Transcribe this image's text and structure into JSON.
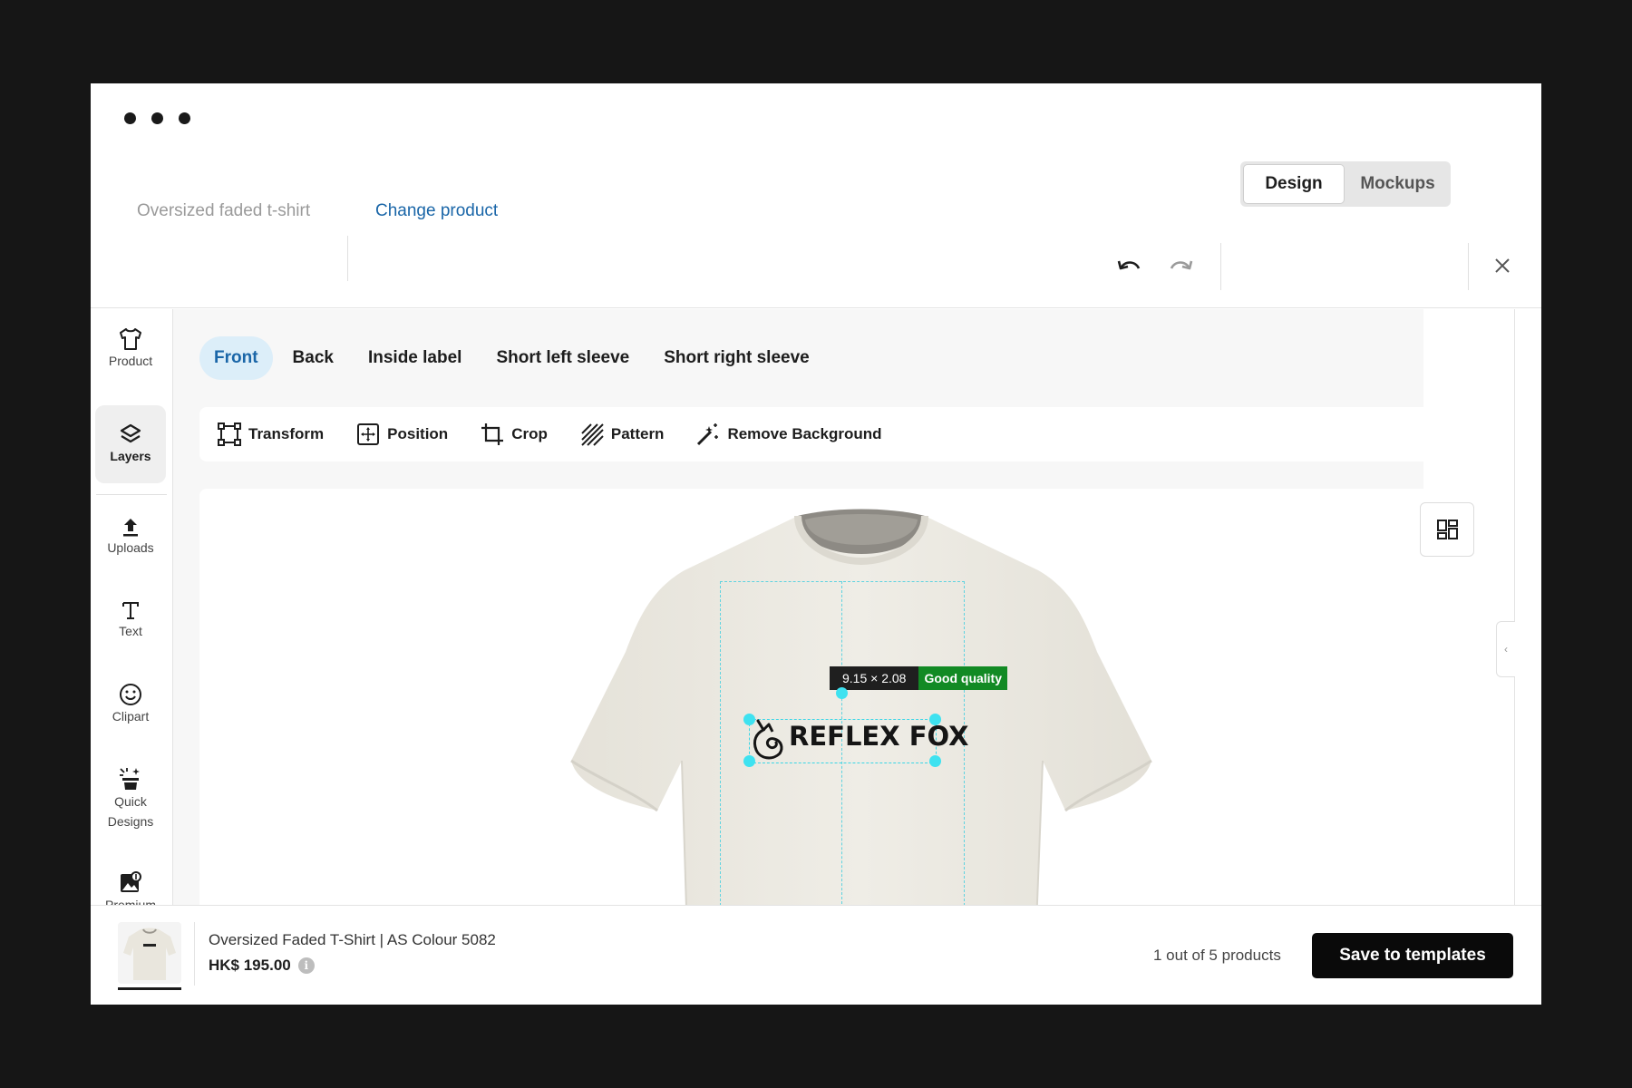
{
  "header": {
    "product_name": "Oversized faded t-shirt",
    "change_product": "Change product",
    "undo_icon": "undo-icon",
    "redo_icon": "redo-icon",
    "view_toggle": {
      "design": "Design",
      "mockups": "Mockups",
      "selected": "Design"
    },
    "close_icon": "close-icon"
  },
  "sidebar": {
    "items": [
      {
        "label": "Product",
        "icon": "tshirt-icon"
      },
      {
        "label": "Layers",
        "icon": "layers-icon",
        "active": true
      },
      {
        "label": "Uploads",
        "icon": "upload-icon"
      },
      {
        "label": "Text",
        "icon": "text-icon"
      },
      {
        "label": "Clipart",
        "icon": "smiley-icon"
      },
      {
        "label": "Quick\nDesigns",
        "icon": "magic-icon"
      },
      {
        "label": "Premium",
        "icon": "premium-image-icon"
      },
      {
        "label": "",
        "icon": "paint-bucket-icon"
      }
    ]
  },
  "tabs": [
    "Front",
    "Back",
    "Inside label",
    "Short left sleeve",
    "Short right sleeve"
  ],
  "active_tab": "Front",
  "toolbar": {
    "transform": "Transform",
    "position": "Position",
    "crop": "Crop",
    "pattern": "Pattern",
    "remove_background": "Remove Background"
  },
  "canvas": {
    "dimensions": "9.15 × 2.08",
    "quality": "Good quality",
    "logo_text": "REFLEX FOX",
    "colors": {
      "guide": "#5fd3e0",
      "handle": "#3ee2f0",
      "quality_ok": "#128a24",
      "shirt": "#eceae3"
    }
  },
  "footer": {
    "product_description": "Oversized Faded T-Shirt | AS Colour 5082",
    "price": "HK$ 195.00",
    "count": "1 out of 5 products",
    "save_button": "Save to templates"
  }
}
